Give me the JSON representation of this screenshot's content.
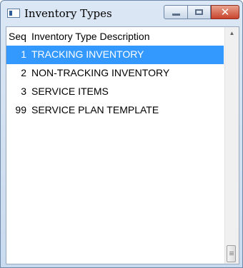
{
  "window": {
    "title": "Inventory Types",
    "icon": "app-window-icon",
    "controls": {
      "minimize_icon": "minimize-icon",
      "maximize_icon": "maximize-icon",
      "close_glyph": "✕"
    }
  },
  "list": {
    "columns": [
      "Seq",
      "Inventory Type Description"
    ],
    "rows": [
      {
        "seq": "1",
        "description": "TRACKING INVENTORY",
        "selected": true
      },
      {
        "seq": "2",
        "description": "NON-TRACKING INVENTORY",
        "selected": false
      },
      {
        "seq": "3",
        "description": "SERVICE ITEMS",
        "selected": false
      },
      {
        "seq": "99",
        "description": "SERVICE PLAN TEMPLATE",
        "selected": false
      }
    ]
  },
  "scrollbar": {
    "up_arrow": "▲"
  },
  "colors": {
    "selection": "#3399ff",
    "close_button": "#c9432c",
    "titlebar": "#dbe7f4"
  }
}
